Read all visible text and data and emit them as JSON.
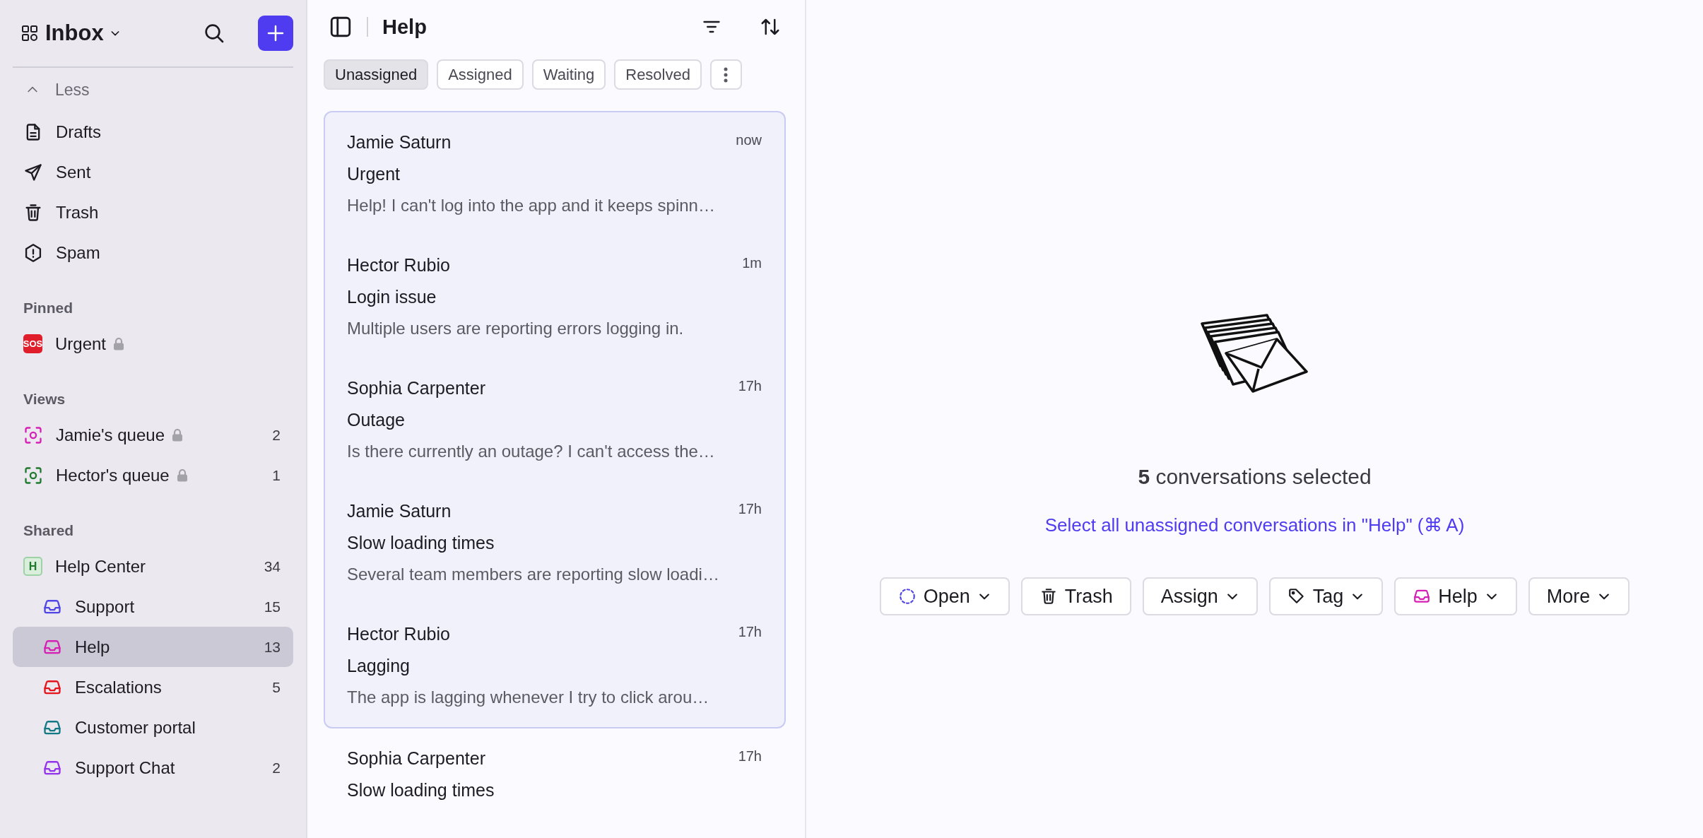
{
  "sidebar": {
    "title": "Inbox",
    "toggle": {
      "label": "Less",
      "expanded": true
    },
    "items": [
      {
        "kind": "drafts",
        "label": "Drafts",
        "selected": false
      },
      {
        "kind": "sent",
        "label": "Sent",
        "selected": false
      },
      {
        "kind": "trash",
        "label": "Trash",
        "selected": false
      },
      {
        "kind": "spam",
        "label": "Spam",
        "selected": false
      }
    ],
    "sections": [
      {
        "title": "Pinned",
        "items": [
          {
            "kind": "sos",
            "badge": "SOS",
            "label": "Urgent",
            "locked": true,
            "selected": false
          }
        ]
      },
      {
        "title": "Views",
        "items": [
          {
            "kind": "view",
            "label": "Jamie's queue",
            "locked": true,
            "count": "2",
            "color": "#d61fb4",
            "selected": false
          },
          {
            "kind": "view",
            "label": "Hector's queue",
            "locked": true,
            "count": "1",
            "color": "#1f7a2e",
            "selected": false
          }
        ]
      },
      {
        "title": "Shared",
        "items": [
          {
            "kind": "team",
            "badge": "H",
            "label": "Help Center",
            "count": "34",
            "selected": false,
            "children": [
              {
                "kind": "inbox",
                "label": "Support",
                "count": "15",
                "color": "#4f46e5",
                "selected": false
              },
              {
                "kind": "inbox",
                "label": "Help",
                "count": "13",
                "color": "#d61fb4",
                "selected": true
              },
              {
                "kind": "inbox",
                "label": "Escalations",
                "count": "5",
                "color": "#e5141c",
                "selected": false
              },
              {
                "kind": "inbox",
                "label": "Customer portal",
                "color": "#137a85",
                "selected": false
              },
              {
                "kind": "inbox",
                "label": "Support Chat",
                "count": "2",
                "color": "#9333ea",
                "selected": false
              }
            ]
          }
        ]
      }
    ]
  },
  "list": {
    "title": "Help",
    "tabs": [
      {
        "label": "Unassigned",
        "selected": true
      },
      {
        "label": "Assigned",
        "selected": false
      },
      {
        "label": "Waiting",
        "selected": false
      },
      {
        "label": "Resolved",
        "selected": false
      }
    ],
    "conversations": [
      {
        "name": "Jamie Saturn",
        "time": "now",
        "subject": "Urgent",
        "preview": "Help! I can't log into the app and it keeps spinn…",
        "selected": true
      },
      {
        "name": "Hector Rubio",
        "time": "1m",
        "subject": "Login issue",
        "preview": "Multiple users are reporting errors logging in.",
        "selected": true
      },
      {
        "name": "Sophia Carpenter",
        "time": "17h",
        "subject": "Outage",
        "preview": "Is there currently an outage? I can't access the…",
        "selected": true
      },
      {
        "name": "Jamie Saturn",
        "time": "17h",
        "subject": "Slow loading times",
        "preview": "Several team members are reporting slow loadi…",
        "selected": true
      },
      {
        "name": "Hector Rubio",
        "time": "17h",
        "subject": "Lagging",
        "preview": "The app is lagging whenever I try to click arou…",
        "selected": true
      },
      {
        "name": "Sophia Carpenter",
        "time": "17h",
        "subject": "Slow loading times",
        "selected": false
      }
    ]
  },
  "selection": {
    "summary": "**5** conversations selected",
    "link": "Select all unassigned conversations in \"Help\" (⌘ A)",
    "actions": [
      {
        "kind": "status",
        "label": "Open",
        "dropdown": true
      },
      {
        "kind": "trash",
        "label": "Trash",
        "dropdown": false
      },
      {
        "kind": "plain",
        "label": "Assign",
        "dropdown": true
      },
      {
        "kind": "tag",
        "label": "Tag",
        "dropdown": true
      },
      {
        "kind": "inbox",
        "label": "Help",
        "dropdown": true,
        "color": "#d61fb4"
      },
      {
        "kind": "plain",
        "label": "More",
        "dropdown": true
      }
    ]
  }
}
